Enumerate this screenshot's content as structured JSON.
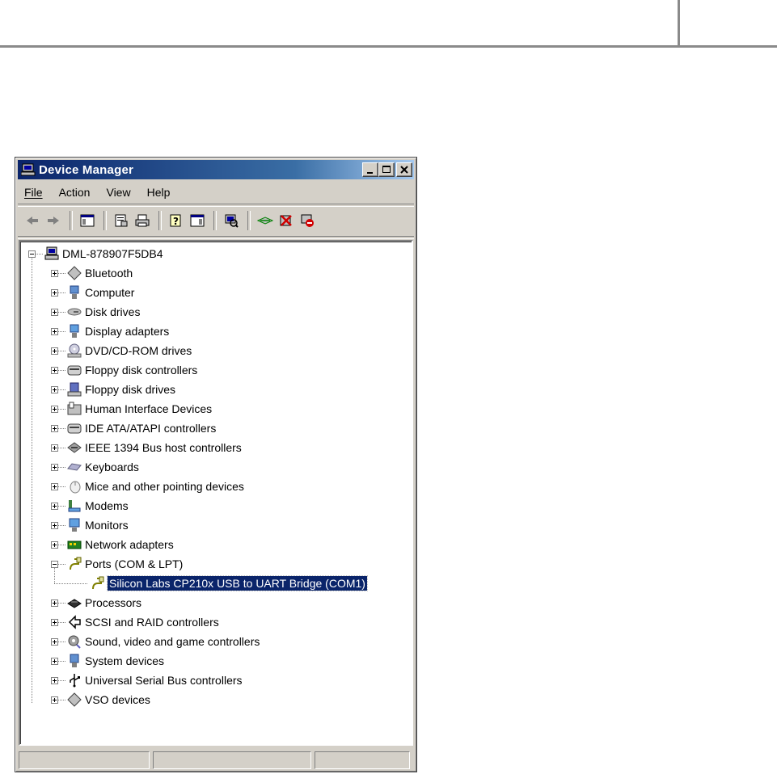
{
  "window": {
    "title": "Device Manager"
  },
  "menu": {
    "file": "File",
    "action": "Action",
    "view": "View",
    "help": "Help"
  },
  "tree": {
    "root": "DML-878907F5DB4",
    "categories": [
      {
        "label": "Bluetooth",
        "icon": "bluetooth-icon"
      },
      {
        "label": "Computer",
        "icon": "computer-icon"
      },
      {
        "label": "Disk drives",
        "icon": "disk-drive-icon"
      },
      {
        "label": "Display adapters",
        "icon": "display-adapter-icon"
      },
      {
        "label": "DVD/CD-ROM drives",
        "icon": "dvd-drive-icon"
      },
      {
        "label": "Floppy disk controllers",
        "icon": "controller-icon"
      },
      {
        "label": "Floppy disk drives",
        "icon": "floppy-drive-icon"
      },
      {
        "label": "Human Interface Devices",
        "icon": "hid-icon"
      },
      {
        "label": "IDE ATA/ATAPI controllers",
        "icon": "controller-icon"
      },
      {
        "label": "IEEE 1394 Bus host controllers",
        "icon": "ieee1394-icon"
      },
      {
        "label": "Keyboards",
        "icon": "keyboard-icon"
      },
      {
        "label": "Mice and other pointing devices",
        "icon": "mouse-icon"
      },
      {
        "label": "Modems",
        "icon": "modem-icon"
      },
      {
        "label": "Monitors",
        "icon": "monitor-icon"
      },
      {
        "label": "Network adapters",
        "icon": "network-adapter-icon"
      },
      {
        "label": "Ports (COM & LPT)",
        "icon": "port-icon",
        "expanded": true
      },
      {
        "label": "Processors",
        "icon": "processor-icon"
      },
      {
        "label": "SCSI and RAID controllers",
        "icon": "scsi-icon"
      },
      {
        "label": "Sound, video and game controllers",
        "icon": "sound-icon"
      },
      {
        "label": "System devices",
        "icon": "system-device-icon"
      },
      {
        "label": "Universal Serial Bus controllers",
        "icon": "usb-icon"
      },
      {
        "label": "VSO devices",
        "icon": "vso-icon"
      }
    ],
    "port_child": "Silicon Labs CP210x USB to UART Bridge (COM1)"
  },
  "colors": {
    "title_start": "#0a246a",
    "title_end": "#a6caf0",
    "selection": "#0a246a",
    "chrome": "#d4d0c8"
  }
}
